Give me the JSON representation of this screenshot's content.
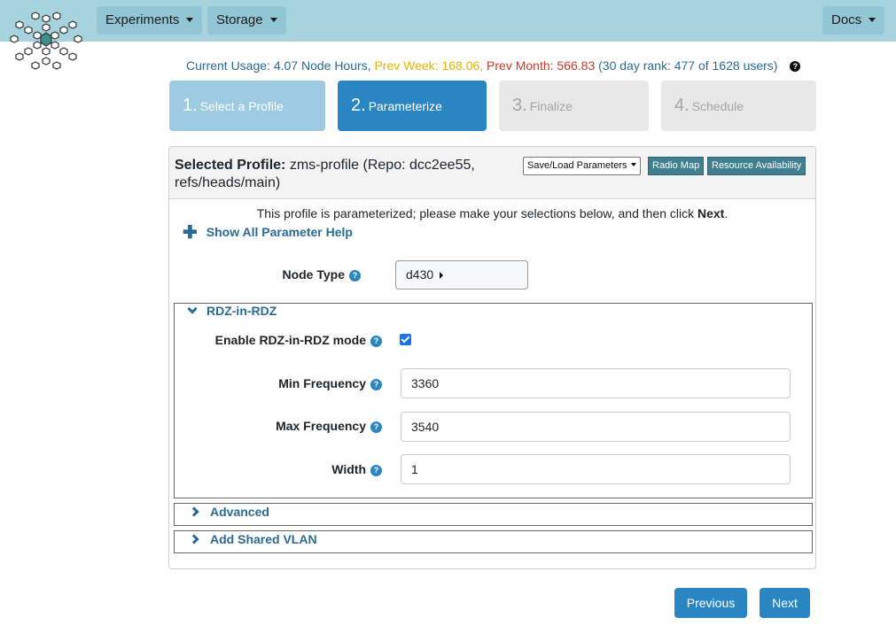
{
  "nav": {
    "experiments_label": "Experiments",
    "storage_label": "Storage",
    "docs_label": "Docs"
  },
  "usage": {
    "current": "Current Usage: 4.07 Node Hours,",
    "prev_week": "Prev Week: 168.06,",
    "prev_month": "Prev Month: 566.83",
    "rank": "(30 day rank: 477 of 1628 users)"
  },
  "steps": [
    {
      "num": "1.",
      "label": "Select a Profile"
    },
    {
      "num": "2.",
      "label": "Parameterize"
    },
    {
      "num": "3.",
      "label": "Finalize"
    },
    {
      "num": "4.",
      "label": "Schedule"
    }
  ],
  "panel": {
    "title_prefix": "Selected Profile:",
    "title_value": "zms-profile (Repo: dcc2ee55, refs/heads/main)",
    "save_load_label": "Save/Load Parameters",
    "radio_map_label": "Radio Map",
    "resource_label": "Resource Availability",
    "intro_text": "This profile is parameterized; please make your selections below, and then click",
    "intro_bold": "Next",
    "intro_end": ".",
    "help_link": "Show All Parameter Help"
  },
  "params": {
    "node_type_label": "Node Type",
    "node_type_value": "d430",
    "rdz_section_title": "RDZ-in-RDZ",
    "enable_label": "Enable RDZ-in-RDZ mode",
    "enable_checked": true,
    "min_freq_label": "Min Frequency",
    "min_freq_value": "3360",
    "max_freq_label": "Max Frequency",
    "max_freq_value": "3540",
    "width_label": "Width",
    "width_value": "1",
    "advanced_title": "Advanced",
    "vlan_title": "Add Shared VLAN"
  },
  "footer": {
    "previous_label": "Previous",
    "next_label": "Next"
  },
  "colors": {
    "topbar": "#a7d3df",
    "accent": "#2a86c2",
    "link": "#2a6b96",
    "prev_week": "#e3b400",
    "prev_month": "#cc3a2a",
    "teal_button": "#3f7f8f"
  },
  "icons": {
    "logo": "snowflake-logo-icon",
    "help": "question-circle-icon",
    "plus": "plus-icon",
    "chevron_down": "chevron-down-icon",
    "chevron_right": "chevron-right-icon"
  }
}
